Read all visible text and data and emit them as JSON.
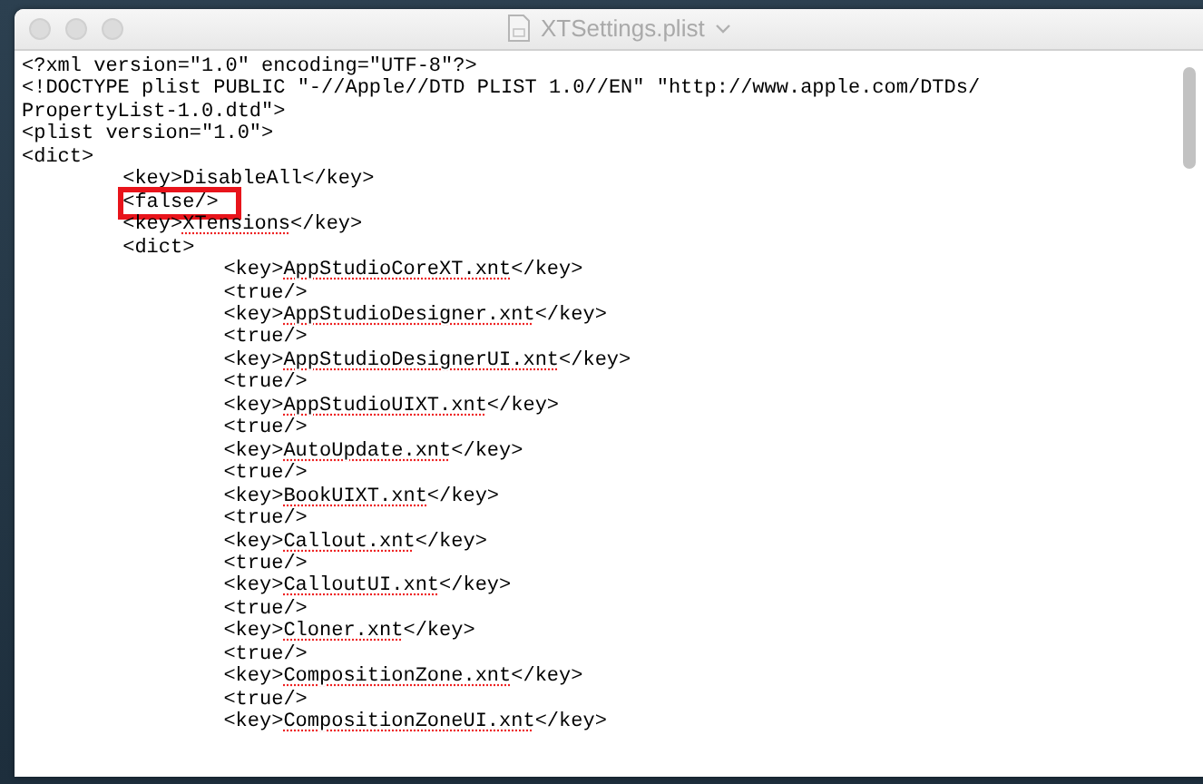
{
  "window": {
    "title": "XTSettings.plist",
    "active": false
  },
  "document": {
    "lines": [
      {
        "parts": [
          {
            "text": "<?xml version=\"1.0\" encoding=\"UTF-8\"?>",
            "misspelled": false
          }
        ]
      },
      {
        "parts": [
          {
            "text": "<!DOCTYPE plist PUBLIC \"-//Apple//DTD PLIST 1.0//EN\" \"http://www.apple.com/DTDs/",
            "misspelled": false
          }
        ]
      },
      {
        "parts": [
          {
            "text": "PropertyList-1.0.dtd\">",
            "misspelled": false
          }
        ]
      },
      {
        "parts": [
          {
            "text": "<plist version=\"1.0\">",
            "misspelled": false
          }
        ]
      },
      {
        "parts": [
          {
            "text": "<dict>",
            "misspelled": false
          }
        ],
        "children": [
          {
            "parts": [
              {
                "text": "<key>DisableAll</key>",
                "misspelled": false
              }
            ]
          },
          {
            "parts": [
              {
                "text": "<false/>",
                "misspelled": false
              }
            ],
            "highlighted": true
          },
          {
            "parts": [
              {
                "text": "<key>",
                "misspelled": false
              },
              {
                "text": "XTensions",
                "misspelled": true
              },
              {
                "text": "</key>",
                "misspelled": false
              }
            ]
          },
          {
            "parts": [
              {
                "text": "<dict>",
                "misspelled": false
              }
            ],
            "children": [
              {
                "parts": [
                  {
                    "text": "<key>",
                    "misspelled": false
                  },
                  {
                    "text": "AppStudioCoreXT.xnt",
                    "misspelled": true
                  },
                  {
                    "text": "</key>",
                    "misspelled": false
                  }
                ]
              },
              {
                "parts": [
                  {
                    "text": "<true/>",
                    "misspelled": false
                  }
                ]
              },
              {
                "parts": [
                  {
                    "text": "<key>",
                    "misspelled": false
                  },
                  {
                    "text": "AppStudioDesigner.xnt",
                    "misspelled": true
                  },
                  {
                    "text": "</key>",
                    "misspelled": false
                  }
                ]
              },
              {
                "parts": [
                  {
                    "text": "<true/>",
                    "misspelled": false
                  }
                ]
              },
              {
                "parts": [
                  {
                    "text": "<key>",
                    "misspelled": false
                  },
                  {
                    "text": "AppStudioDesignerUI.xnt",
                    "misspelled": true
                  },
                  {
                    "text": "</key>",
                    "misspelled": false
                  }
                ]
              },
              {
                "parts": [
                  {
                    "text": "<true/>",
                    "misspelled": false
                  }
                ]
              },
              {
                "parts": [
                  {
                    "text": "<key>",
                    "misspelled": false
                  },
                  {
                    "text": "AppStudioUIXT.xnt",
                    "misspelled": true
                  },
                  {
                    "text": "</key>",
                    "misspelled": false
                  }
                ]
              },
              {
                "parts": [
                  {
                    "text": "<true/>",
                    "misspelled": false
                  }
                ]
              },
              {
                "parts": [
                  {
                    "text": "<key>",
                    "misspelled": false
                  },
                  {
                    "text": "AutoUpdate.xnt",
                    "misspelled": true
                  },
                  {
                    "text": "</key>",
                    "misspelled": false
                  }
                ]
              },
              {
                "parts": [
                  {
                    "text": "<true/>",
                    "misspelled": false
                  }
                ]
              },
              {
                "parts": [
                  {
                    "text": "<key>",
                    "misspelled": false
                  },
                  {
                    "text": "BookUIXT.xnt",
                    "misspelled": true
                  },
                  {
                    "text": "</key>",
                    "misspelled": false
                  }
                ]
              },
              {
                "parts": [
                  {
                    "text": "<true/>",
                    "misspelled": false
                  }
                ]
              },
              {
                "parts": [
                  {
                    "text": "<key>",
                    "misspelled": false
                  },
                  {
                    "text": "Callout.xnt",
                    "misspelled": true
                  },
                  {
                    "text": "</key>",
                    "misspelled": false
                  }
                ]
              },
              {
                "parts": [
                  {
                    "text": "<true/>",
                    "misspelled": false
                  }
                ]
              },
              {
                "parts": [
                  {
                    "text": "<key>",
                    "misspelled": false
                  },
                  {
                    "text": "CalloutUI.xnt",
                    "misspelled": true
                  },
                  {
                    "text": "</key>",
                    "misspelled": false
                  }
                ]
              },
              {
                "parts": [
                  {
                    "text": "<true/>",
                    "misspelled": false
                  }
                ]
              },
              {
                "parts": [
                  {
                    "text": "<key>",
                    "misspelled": false
                  },
                  {
                    "text": "Cloner.xnt",
                    "misspelled": true
                  },
                  {
                    "text": "</key>",
                    "misspelled": false
                  }
                ]
              },
              {
                "parts": [
                  {
                    "text": "<true/>",
                    "misspelled": false
                  }
                ]
              },
              {
                "parts": [
                  {
                    "text": "<key>",
                    "misspelled": false
                  },
                  {
                    "text": "CompositionZone.xnt",
                    "misspelled": true
                  },
                  {
                    "text": "</key>",
                    "misspelled": false
                  }
                ]
              },
              {
                "parts": [
                  {
                    "text": "<true/>",
                    "misspelled": false
                  }
                ]
              },
              {
                "parts": [
                  {
                    "text": "<key>",
                    "misspelled": false
                  },
                  {
                    "text": "CompositionZoneUI.xnt",
                    "misspelled": true
                  },
                  {
                    "text": "</key>",
                    "misspelled": false
                  }
                ]
              }
            ]
          }
        ]
      }
    ]
  }
}
